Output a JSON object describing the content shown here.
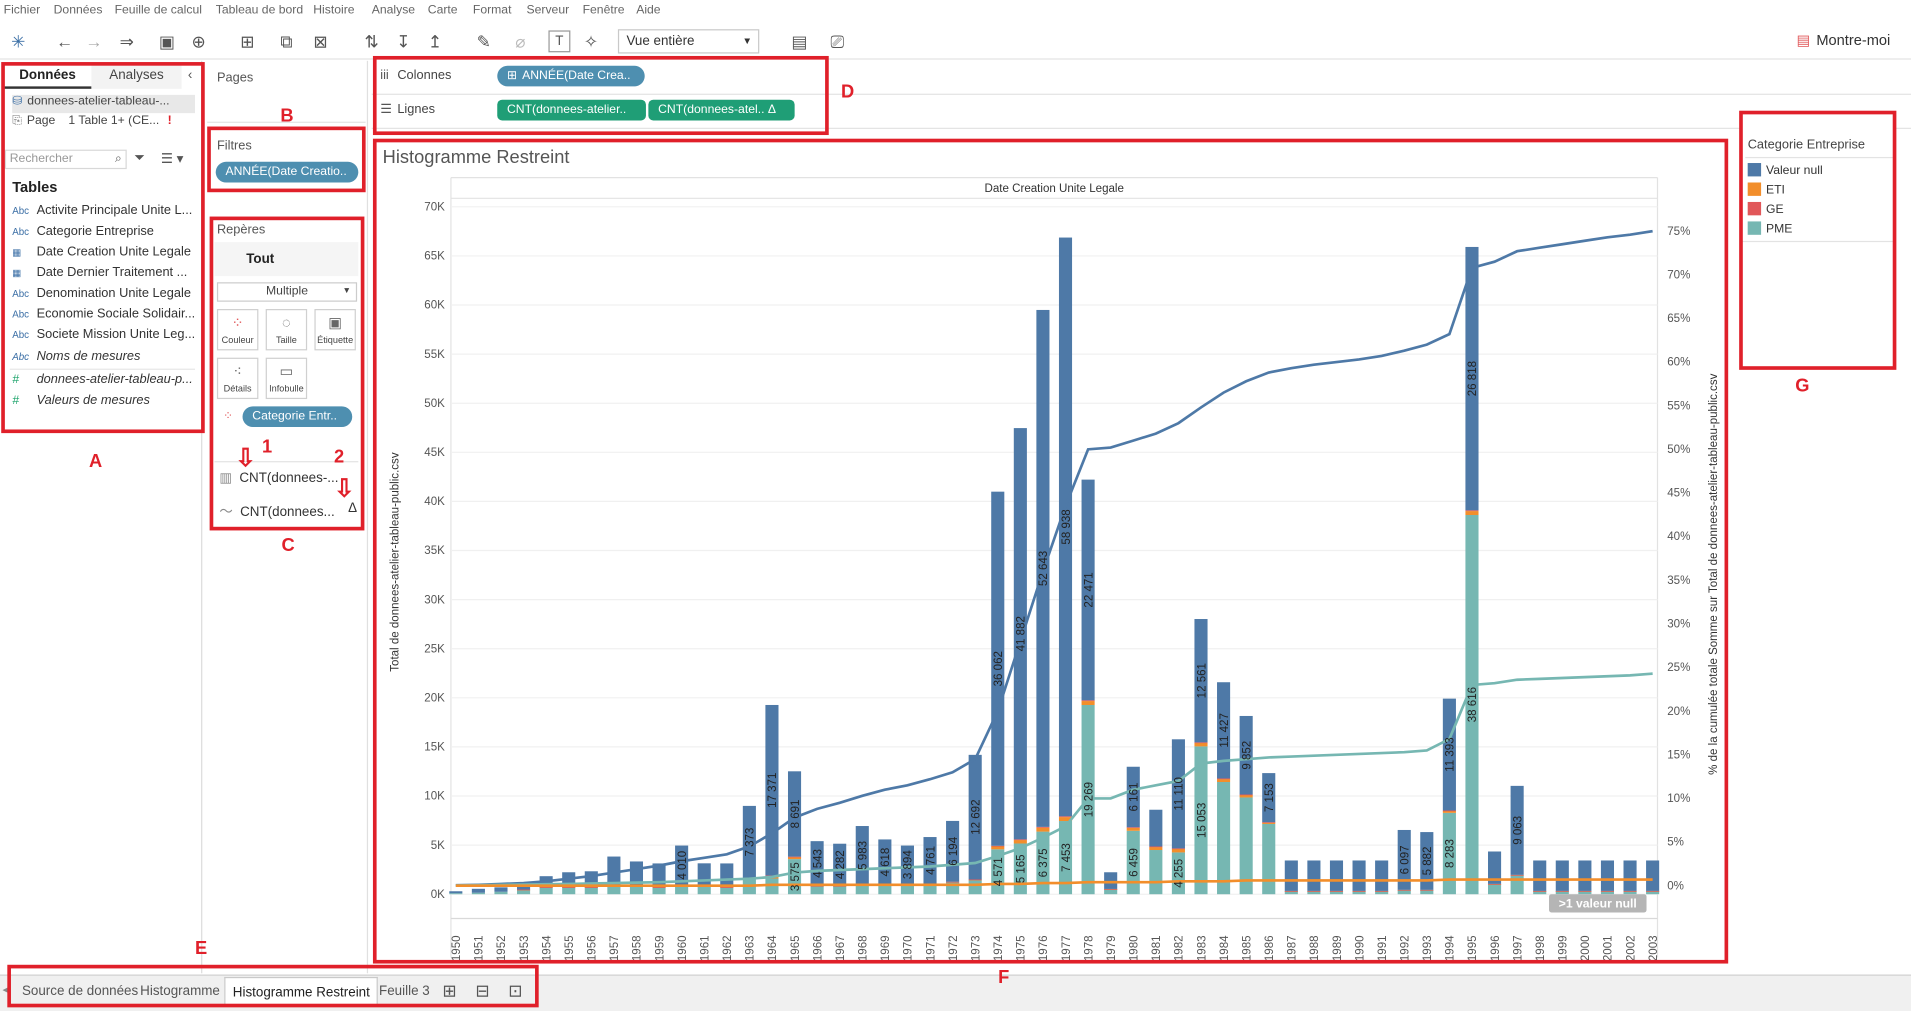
{
  "menu": [
    "Fichier",
    "Données",
    "Feuille de calcul",
    "Tableau de bord",
    "Histoire",
    "Analyse",
    "Carte",
    "Format",
    "Serveur",
    "Fenêtre",
    "Aide"
  ],
  "toolbar": {
    "view_select": "Vue entière",
    "show_me": "Montre-moi"
  },
  "data_pane": {
    "tab_data": "Données",
    "tab_analytics": "Analyses",
    "source": "donnees-atelier-tableau-...",
    "page_row": "Page",
    "page_detail": "1 Table 1+ (CE...",
    "search_placeholder": "Rechercher",
    "tables_heading": "Tables",
    "fields": [
      {
        "icon": "Abc",
        "name": "Activite Principale Unite L..."
      },
      {
        "icon": "Abc",
        "name": "Categorie Entreprise"
      },
      {
        "icon": "cal",
        "name": "Date Creation Unite Legale"
      },
      {
        "icon": "cal",
        "name": "Date Dernier Traitement ..."
      },
      {
        "icon": "Abc",
        "name": "Denomination Unite Legale"
      },
      {
        "icon": "Abc",
        "name": "Economie Sociale Solidair..."
      },
      {
        "icon": "Abc",
        "name": "Societe Mission Unite Leg..."
      },
      {
        "icon": "Abc",
        "name": "Noms de mesures"
      },
      {
        "icon": "#",
        "name": "donnees-atelier-tableau-p..."
      },
      {
        "icon": "#",
        "name": "Valeurs de mesures"
      }
    ]
  },
  "pages_card": {
    "title": "Pages"
  },
  "filters_card": {
    "title": "Filtres",
    "pill": "ANNÉE(Date Creatio.."
  },
  "marks_card": {
    "title": "Repères",
    "all": "Tout",
    "type": "Multiple",
    "buttons": [
      "Couleur",
      "Taille",
      "Étiquette",
      "Détails",
      "Infobulle"
    ],
    "color_pill": "Categorie Entr..",
    "layer1": "CNT(donnees-...",
    "layer2": "CNT(donnees...",
    "layer2_badge": "Δ"
  },
  "shelves": {
    "columns_label": "Colonnes",
    "columns_pill": "ANNÉE(Date Crea..",
    "rows_label": "Lignes",
    "rows_pill1": "CNT(donnees-atelier..",
    "rows_pill2": "CNT(donnees-atel..",
    "rows_pill2_badge": "Δ"
  },
  "legend": {
    "title": "Categorie Entreprise",
    "items": [
      {
        "label": "Valeur null",
        "color": "#4e79a7"
      },
      {
        "label": "ETI",
        "color": "#f28e2b"
      },
      {
        "label": "GE",
        "color": "#e15759"
      },
      {
        "label": "PME",
        "color": "#76b7b2"
      }
    ]
  },
  "sheet_tabs": [
    "Source de données",
    "Histogramme",
    "Histogramme Restreint",
    "Feuille 3"
  ],
  "annotations": {
    "A": "A",
    "B": "B",
    "C": "C",
    "D": "D",
    "E": "E",
    "F": "F",
    "G": "G",
    "n1": "1",
    "n2": "2"
  },
  "chart_data": {
    "type": "bar",
    "title": "Histogramme Restreint",
    "header": "Date Creation Unite Legale",
    "ylabel": "Total de donnees-atelier-tableau-public.csv",
    "y2label": "% de la cumulée totale Somme sur Total de donnees-atelier-tableau-public.csv",
    "ylim": [
      0,
      70000
    ],
    "y2lim": [
      0,
      0.75
    ],
    "y_ticks": [
      "0K",
      "5K",
      "10K",
      "15K",
      "20K",
      "25K",
      "30K",
      "35K",
      "40K",
      "45K",
      "50K",
      "55K",
      "60K",
      "65K",
      "70K"
    ],
    "y2_ticks": [
      "0%",
      "5%",
      "10%",
      "15%",
      "20%",
      "25%",
      "30%",
      "35%",
      "40%",
      "45%",
      "50%",
      "55%",
      "60%",
      "65%",
      "70%",
      "75%"
    ],
    "null_badge": ">1 valeur null",
    "categories": [
      "1950",
      "1951",
      "1952",
      "1953",
      "1954",
      "1955",
      "1956",
      "1957",
      "1958",
      "1959",
      "1960",
      "1961",
      "1962",
      "1963",
      "1964",
      "1965",
      "1966",
      "1967",
      "1968",
      "1969",
      "1970",
      "1971",
      "1972",
      "1973",
      "1974",
      "1975",
      "1976",
      "1977",
      "1978",
      "1979",
      "1980",
      "1981",
      "1982",
      "1983",
      "1984",
      "1985",
      "1986",
      "1987",
      "1988",
      "1989",
      "1990",
      "1991",
      "1992",
      "1993",
      "1994",
      "1995",
      "1996",
      "1997",
      "1998",
      "1999",
      "2000",
      "2001",
      "2002",
      "2003"
    ],
    "series": [
      {
        "name": "PME",
        "color": "#76b7b2",
        "values": [
          100,
          150,
          250,
          450,
          700,
          700,
          700,
          900,
          800,
          700,
          900,
          900,
          700,
          1500,
          1600,
          3575,
          800,
          800,
          900,
          900,
          1000,
          1000,
          1200,
          1400,
          4571,
          5165,
          6375,
          7453,
          19269,
          500,
          6459,
          4500,
          4255,
          15053,
          11427,
          9852,
          7153,
          300,
          300,
          300,
          300,
          300,
          400,
          400,
          8283,
          38616,
          1000,
          1900,
          300,
          300,
          300,
          300,
          300,
          300
        ]
      },
      {
        "name": "ETI",
        "color": "#f28e2b",
        "values": [
          0,
          0,
          0,
          20,
          30,
          30,
          30,
          30,
          30,
          30,
          40,
          40,
          30,
          100,
          250,
          200,
          50,
          50,
          50,
          50,
          50,
          50,
          60,
          80,
          300,
          350,
          400,
          400,
          400,
          30,
          300,
          300,
          350,
          350,
          300,
          250,
          150,
          30,
          30,
          30,
          30,
          30,
          40,
          40,
          200,
          400,
          40,
          60,
          30,
          30,
          30,
          30,
          30,
          30
        ]
      },
      {
        "name": "GE",
        "color": "#e15759",
        "values": [
          0,
          0,
          0,
          5,
          5,
          5,
          5,
          5,
          5,
          5,
          5,
          5,
          5,
          20,
          50,
          50,
          10,
          10,
          10,
          10,
          10,
          10,
          10,
          20,
          60,
          70,
          80,
          80,
          80,
          5,
          60,
          60,
          60,
          60,
          60,
          50,
          30,
          5,
          5,
          5,
          5,
          5,
          5,
          5,
          40,
          80,
          10,
          10,
          5,
          5,
          5,
          5,
          5,
          5
        ]
      },
      {
        "name": "Valeur null",
        "color": "#4e79a7",
        "values": [
          200,
          400,
          450,
          750,
          1100,
          1500,
          1600,
          2900,
          2500,
          2400,
          4010,
          2200,
          2400,
          7373,
          17371,
          8691,
          4543,
          4282,
          5983,
          4618,
          3894,
          4761,
          6194,
          12692,
          36062,
          41882,
          52643,
          58938,
          22471,
          1700,
          6161,
          3742,
          11110,
          12561,
          9800,
          8000,
          5000,
          3100,
          3100,
          3100,
          3100,
          3100,
          6097,
          5882,
          11393,
          26818,
          3300,
          9063,
          3100,
          3100,
          3100,
          3100,
          3100,
          3100
        ]
      }
    ],
    "bar_labels": {
      "Valeur null": {
        "1960": "4 010",
        "1963": "7 373",
        "1964": "17 371",
        "1965": "8 691",
        "1966": "4 543",
        "1967": "4 282",
        "1968": "5 983",
        "1969": "4 618",
        "1970": "3 894",
        "1971": "4 761",
        "1972": "6 194",
        "1973": "12 692",
        "1974": "36 062",
        "1975": "41 882",
        "1976": "52 643",
        "1977": "58 938",
        "1978": "22 471",
        "1980": "6 161",
        "1982": "11 110",
        "1983": "12 561",
        "1984": "11 427",
        "1985": "9 852",
        "1986": "7 153",
        "1992": "6 097",
        "1993": "5 882",
        "1994": "11 393",
        "1995": "26 818",
        "1997": "9 063"
      },
      "PME": {
        "1965": "3 575",
        "1974": "4 571",
        "1975": "5 165",
        "1976": "6 375",
        "1977": "7 453",
        "1978": "19 269",
        "1980": "6 459",
        "1982": "4 255",
        "1983": "15 053",
        "1994": "8 283",
        "1995": "38 616"
      }
    },
    "cumulative_lines": [
      {
        "name": "Valeur null",
        "color": "#4e79a7",
        "values": [
          0.0005,
          0.001,
          0.002,
          0.003,
          0.005,
          0.008,
          0.011,
          0.015,
          0.019,
          0.023,
          0.028,
          0.032,
          0.036,
          0.045,
          0.06,
          0.078,
          0.088,
          0.095,
          0.103,
          0.11,
          0.115,
          0.122,
          0.13,
          0.145,
          0.2,
          0.28,
          0.36,
          0.435,
          0.5,
          0.502,
          0.51,
          0.518,
          0.53,
          0.548,
          0.565,
          0.578,
          0.588,
          0.593,
          0.597,
          0.6,
          0.603,
          0.607,
          0.613,
          0.62,
          0.632,
          0.708,
          0.715,
          0.727,
          0.731,
          0.735,
          0.739,
          0.743,
          0.746,
          0.75
        ]
      },
      {
        "name": "PME",
        "color": "#76b7b2",
        "values": [
          0.0003,
          0.0006,
          0.001,
          0.0013,
          0.0017,
          0.002,
          0.0025,
          0.003,
          0.0035,
          0.004,
          0.005,
          0.006,
          0.007,
          0.008,
          0.01,
          0.015,
          0.017,
          0.018,
          0.019,
          0.02,
          0.021,
          0.022,
          0.024,
          0.026,
          0.034,
          0.043,
          0.055,
          0.068,
          0.1,
          0.1,
          0.11,
          0.115,
          0.12,
          0.14,
          0.143,
          0.145,
          0.147,
          0.148,
          0.149,
          0.15,
          0.151,
          0.152,
          0.153,
          0.155,
          0.168,
          0.23,
          0.232,
          0.236,
          0.237,
          0.238,
          0.239,
          0.24,
          0.241,
          0.243
        ]
      },
      {
        "name": "ETI",
        "color": "#f28e2b",
        "values": [
          0,
          0,
          0,
          0,
          0,
          0,
          0,
          0,
          0,
          0,
          0,
          0,
          0,
          0,
          0.001,
          0.001,
          0.001,
          0.001,
          0.001,
          0.001,
          0.001,
          0.001,
          0.001,
          0.001,
          0.002,
          0.002,
          0.003,
          0.003,
          0.004,
          0.004,
          0.004,
          0.004,
          0.005,
          0.005,
          0.005,
          0.006,
          0.006,
          0.006,
          0.006,
          0.006,
          0.006,
          0.006,
          0.006,
          0.006,
          0.007,
          0.007,
          0.007,
          0.007,
          0.007,
          0.007,
          0.007,
          0.007,
          0.007,
          0.007
        ]
      }
    ]
  }
}
